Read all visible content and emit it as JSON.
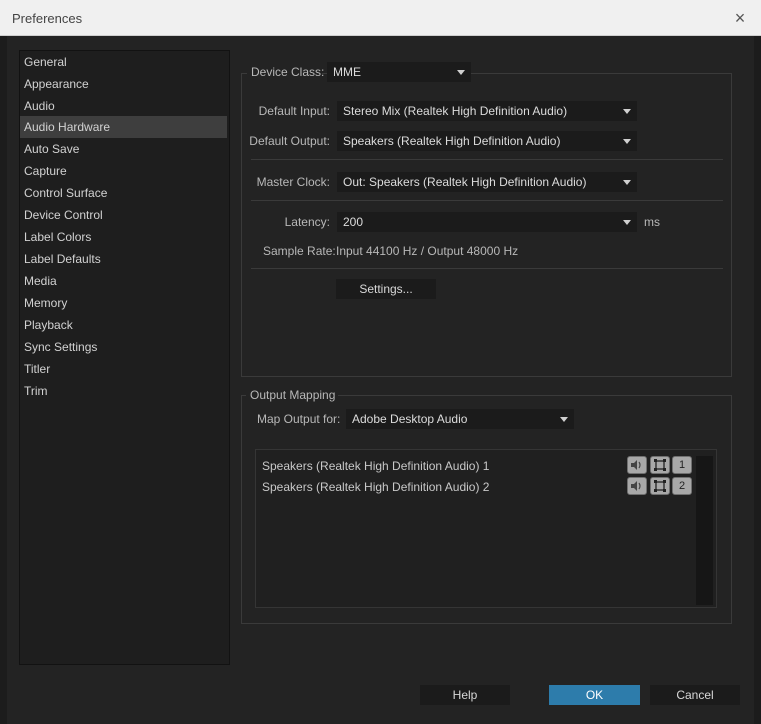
{
  "window": {
    "title": "Preferences",
    "close_glyph": "×"
  },
  "sidebar": {
    "items": [
      {
        "label": "General",
        "selected": false
      },
      {
        "label": "Appearance",
        "selected": false
      },
      {
        "label": "Audio",
        "selected": false
      },
      {
        "label": "Audio Hardware",
        "selected": true
      },
      {
        "label": "Auto Save",
        "selected": false
      },
      {
        "label": "Capture",
        "selected": false
      },
      {
        "label": "Control Surface",
        "selected": false
      },
      {
        "label": "Device Control",
        "selected": false
      },
      {
        "label": "Label Colors",
        "selected": false
      },
      {
        "label": "Label Defaults",
        "selected": false
      },
      {
        "label": "Media",
        "selected": false
      },
      {
        "label": "Memory",
        "selected": false
      },
      {
        "label": "Playback",
        "selected": false
      },
      {
        "label": "Sync Settings",
        "selected": false
      },
      {
        "label": "Titler",
        "selected": false
      },
      {
        "label": "Trim",
        "selected": false
      }
    ]
  },
  "hardware": {
    "device_class_label": "Device Class:",
    "device_class_value": "MME",
    "default_input_label": "Default Input:",
    "default_input_value": "Stereo Mix (Realtek High Definition Audio)",
    "default_output_label": "Default Output:",
    "default_output_value": "Speakers (Realtek High Definition Audio)",
    "master_clock_label": "Master Clock:",
    "master_clock_value": "Out: Speakers (Realtek High Definition Audio)",
    "latency_label": "Latency:",
    "latency_value": "200",
    "latency_unit": "ms",
    "sample_rate_label": "Sample Rate:",
    "sample_rate_value": "Input 44100 Hz / Output 48000 Hz",
    "settings_button": "Settings..."
  },
  "output_mapping": {
    "section_title": "Output Mapping",
    "map_output_for_label": "Map Output for:",
    "map_output_for_value": "Adobe Desktop Audio",
    "rows": [
      {
        "label": "Speakers (Realtek High Definition Audio) 1",
        "channel": "1"
      },
      {
        "label": "Speakers (Realtek High Definition Audio) 2",
        "channel": "2"
      }
    ]
  },
  "footer": {
    "help": "Help",
    "ok": "OK",
    "cancel": "Cancel"
  },
  "colors": {
    "accent": "#2d7cab",
    "selected_item": "#3e3e3e",
    "background": "#232323"
  }
}
